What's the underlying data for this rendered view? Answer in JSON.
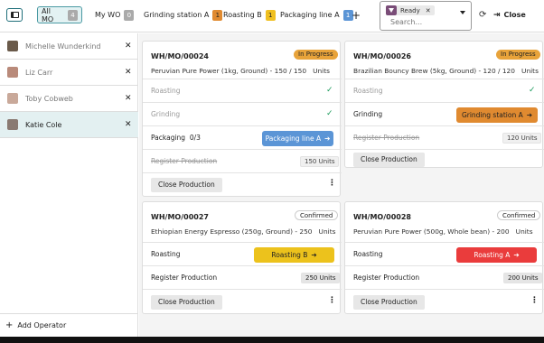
{
  "toolbar": {
    "all_mo": {
      "label": "All MO",
      "count": "4"
    },
    "my_wo": {
      "label": "My WO",
      "count": "0"
    },
    "workcenters": [
      {
        "label": "Grinding station A",
        "count": "1"
      },
      {
        "label": "Roasting B",
        "count": "1"
      },
      {
        "label": "Packaging line A",
        "count": "1"
      }
    ],
    "add_icon": "+",
    "search": {
      "facet": "Ready",
      "placeholder": "Search..."
    },
    "close_label": "Close"
  },
  "operators": [
    {
      "name": "Michelle Wunderkind",
      "active": false
    },
    {
      "name": "Liz Carr",
      "active": false
    },
    {
      "name": "Toby Cobweb",
      "active": false
    },
    {
      "name": "Katie Cole",
      "active": true
    }
  ],
  "add_operator_label": "Add Operator",
  "cards": [
    {
      "mo": "WH/MO/00024",
      "state": "In Progress",
      "product": "Peruvian Pure Power (1kg, Ground) - 150 / 150",
      "uom": "Units",
      "rows": [
        {
          "label": "Roasting",
          "done": true
        },
        {
          "label": "Grinding",
          "done": true
        },
        {
          "label": "Packaging",
          "progress": "0/3",
          "button": "Packaging line A",
          "color": "#5b95d6"
        },
        {
          "label": "Register Production",
          "done": true,
          "qty": "150 Units"
        }
      ],
      "close_label": "Close Production"
    },
    {
      "mo": "WH/MO/00026",
      "state": "In Progress",
      "product": "Brazilian Bouncy Brew (5kg, Ground) - 120 / 120",
      "uom": "Units",
      "rows": [
        {
          "label": "Roasting",
          "done": true
        },
        {
          "label": "Grinding",
          "button": "Grinding station A",
          "color": "#e08a30"
        },
        {
          "label": "Register Production",
          "done": true,
          "qty": "120 Units"
        }
      ],
      "close_label": "Close Production"
    },
    {
      "mo": "WH/MO/00027",
      "state": "Confirmed",
      "product": "Ethiopian Energy Espresso (250g, Ground) - 250",
      "uom": "Units",
      "rows": [
        {
          "label": "Roasting",
          "button": "Roasting B",
          "color": "#ecc21c"
        },
        {
          "label": "Register Production",
          "qty": "250 Units"
        }
      ],
      "close_label": "Close Production"
    },
    {
      "mo": "WH/MO/00028",
      "state": "Confirmed",
      "product": "Peruvian Pure Power (500g, Whole bean) - 200",
      "uom": "Units",
      "rows": [
        {
          "label": "Roasting",
          "button": "Roasting A",
          "color": "#ea3c3c"
        },
        {
          "label": "Register Production",
          "qty": "200 Units"
        }
      ],
      "close_label": "Close Production"
    }
  ]
}
